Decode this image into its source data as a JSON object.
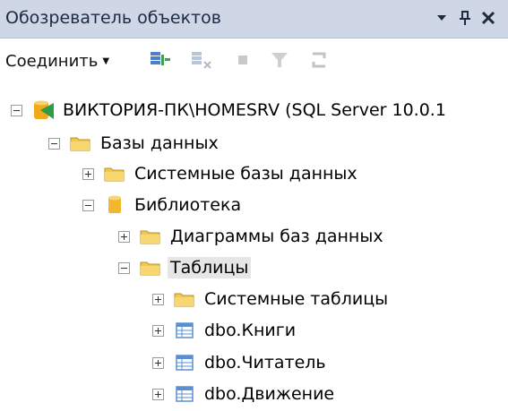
{
  "panel": {
    "title": "Обозреватель объектов",
    "controls": {
      "dropdown_icon": "dropdown-arrow-icon",
      "pin_icon": "pin-icon",
      "close_icon": "close-icon"
    }
  },
  "toolbar": {
    "connect_label": "Соединить",
    "buttons": [
      {
        "icon": "connect-object-explorer-icon"
      },
      {
        "icon": "disconnect-icon"
      },
      {
        "icon": "stop-icon"
      },
      {
        "icon": "filter-icon"
      },
      {
        "icon": "refresh-icon"
      }
    ]
  },
  "tree": {
    "nodes": [
      {
        "label": "ВИКТОРИЯ-ПК\\HOMESRV (SQL Server 10.0.1",
        "expanded": true,
        "icon": "server-icon"
      },
      {
        "label": "Базы данных",
        "expanded": true,
        "icon": "folder-icon"
      },
      {
        "label": "Системные базы данных",
        "expanded": false,
        "icon": "folder-icon"
      },
      {
        "label": "Библиотека",
        "expanded": true,
        "icon": "database-icon"
      },
      {
        "label": "Диаграммы баз данных",
        "expanded": false,
        "icon": "folder-icon"
      },
      {
        "label": "Таблицы",
        "expanded": true,
        "icon": "folder-icon",
        "selected": true
      },
      {
        "label": "Системные таблицы",
        "expanded": false,
        "icon": "folder-icon"
      },
      {
        "label": "dbo.Книги",
        "expanded": false,
        "icon": "table-icon"
      },
      {
        "label": "dbo.Читатель",
        "expanded": false,
        "icon": "table-icon"
      },
      {
        "label": "dbo.Движение",
        "expanded": false,
        "icon": "table-icon"
      }
    ]
  },
  "colors": {
    "titlebar": "#cfd6e5",
    "folder": "#f3c84b",
    "database": "#f2b72d",
    "server_accent": "#3aa34a",
    "table": "#5b8fd1",
    "selection": "#e6e6e6"
  }
}
